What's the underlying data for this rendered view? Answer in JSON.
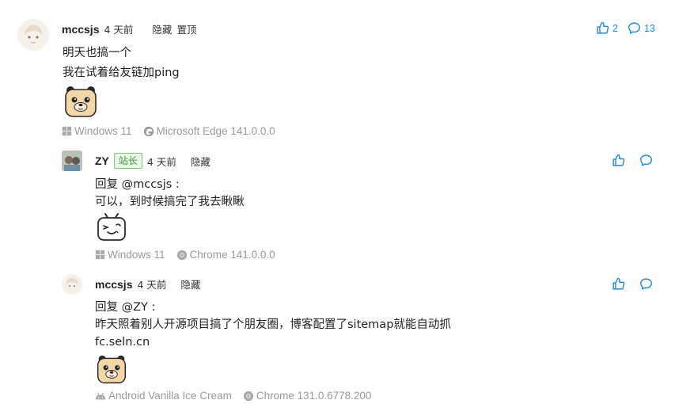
{
  "comment": {
    "author": "mccsjs",
    "time": "4 天前",
    "hide_label": "隐藏",
    "pin_label": "置顶",
    "likes": "2",
    "replies": "13",
    "lines": [
      "明天也搞一个",
      "我在试着给友链加ping"
    ],
    "sticker": "bear-sticker",
    "os": "Windows 11",
    "browser": "Microsoft Edge 141.0.0.0"
  },
  "reply1": {
    "author": "ZY",
    "badge": "站长",
    "time": "4 天前",
    "hide_label": "隐藏",
    "reply_to": "回复 @mccsjs :",
    "lines": [
      "可以，到时候搞完了我去瞅瞅"
    ],
    "sticker": "tv-sticker",
    "os": "Windows 11",
    "browser": "Chrome 141.0.0.0"
  },
  "reply2": {
    "author": "mccsjs",
    "time": "4 天前",
    "hide_label": "隐藏",
    "reply_to": "回复 @ZY :",
    "lines": [
      "昨天照着别人开源项目搞了个朋友圈，博客配置了sitemap就能自动抓",
      "fc.seln.cn"
    ],
    "sticker": "bear-sticker",
    "os": "Android Vanilla Ice Cream",
    "browser": "Chrome 131.0.6778.200"
  },
  "colors": {
    "accent": "#1e88e5",
    "muted": "#999999",
    "badge_green": "#3a9a3a"
  }
}
